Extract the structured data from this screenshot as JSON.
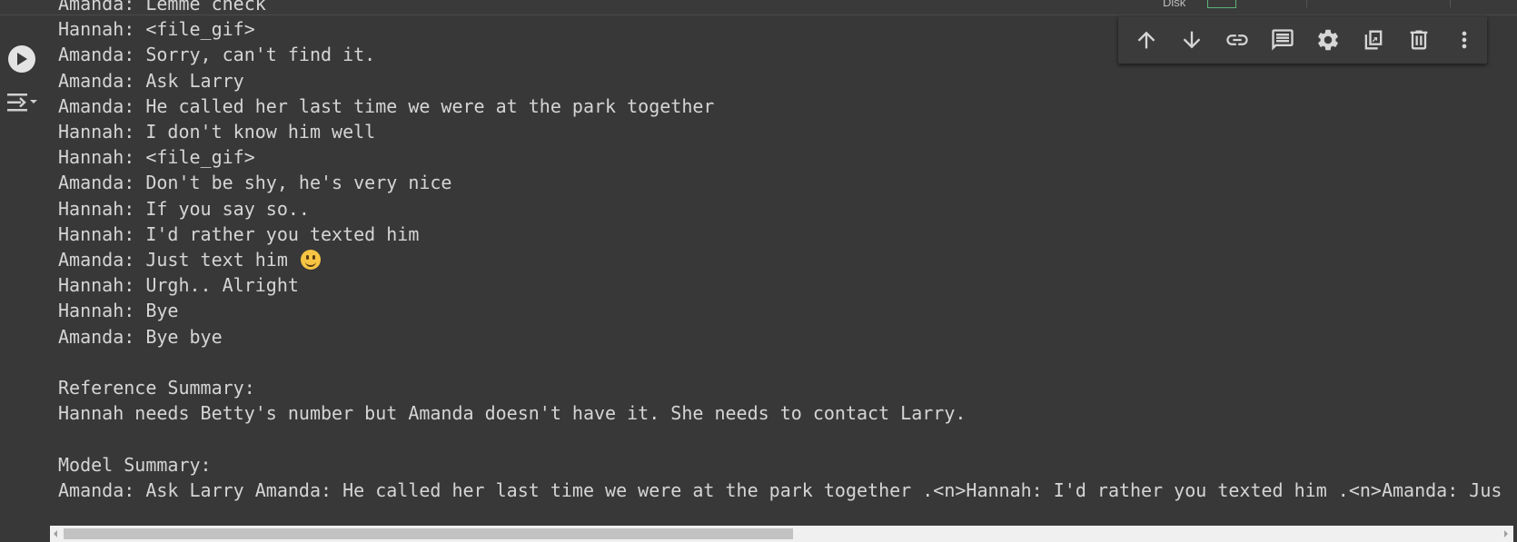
{
  "header": {
    "disk_label": "Disk"
  },
  "output": {
    "lines": [
      "Amanda: Lemme check",
      "Hannah: <file_gif>",
      "Amanda: Sorry, can't find it.",
      "Amanda: Ask Larry",
      "Amanda: He called her last time we were at the park together",
      "Hannah: I don't know him well",
      "Hannah: <file_gif>",
      "Amanda: Don't be shy, he's very nice",
      "Hannah: If you say so..",
      "Hannah: I'd rather you texted him",
      "Amanda: Just text him ",
      "Hannah: Urgh.. Alright",
      "Hannah: Bye",
      "Amanda: Bye bye",
      "",
      "Reference Summary:",
      "Hannah needs Betty's number but Amanda doesn't have it. She needs to contact Larry.",
      "",
      "Model Summary:",
      "Amanda: Ask Larry Amanda: He called her last time we were at the park together .<n>Hannah: I'd rather you texted him .<n>Amanda: Just text him"
    ],
    "emoji_line_index": 10,
    "emoji_name": "slightly-smiling-face-emoji"
  },
  "toolbar": {
    "icons": [
      "arrow-up-icon",
      "arrow-down-icon",
      "link-icon",
      "comment-icon",
      "gear-icon",
      "mirror-cell-icon",
      "trash-icon",
      "more-vert-icon"
    ]
  },
  "gutter": {
    "icons": [
      "run-icon",
      "output-toggle-icon"
    ]
  },
  "colors": {
    "background": "#383838",
    "text": "#d5d5d5",
    "toolbar": "#3b3b3b",
    "run_button": "#e3e3e3",
    "disk_bar": "#5fb37a"
  }
}
